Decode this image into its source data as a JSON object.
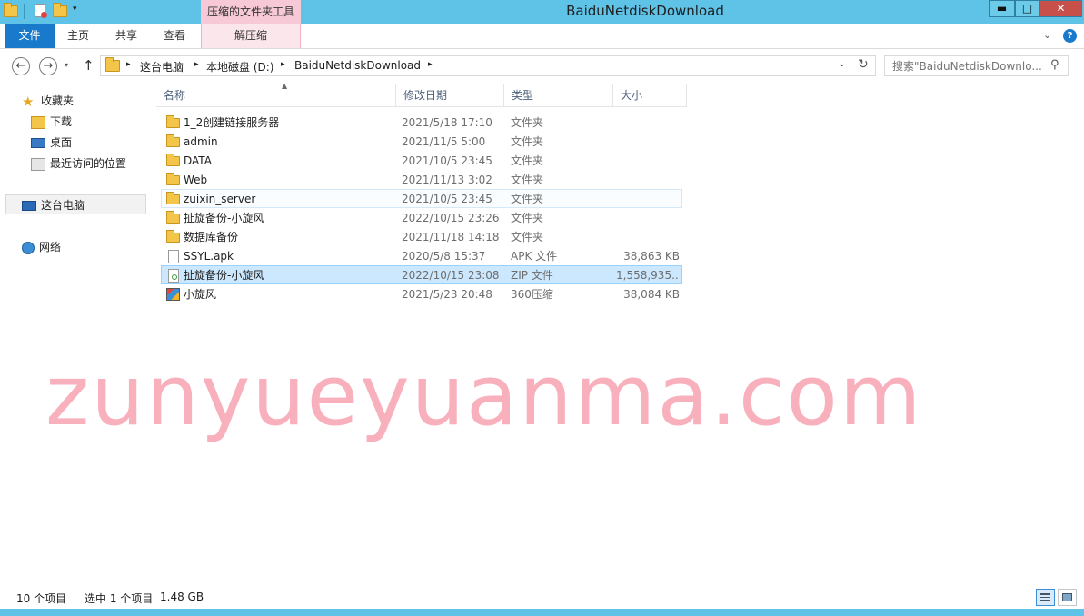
{
  "window": {
    "title": "BaiduNetdiskDownload"
  },
  "titlebar": {
    "context_tab_group": "压缩的文件夹工具",
    "minimize_symbol": "▬",
    "maximize_symbol": "□",
    "close_symbol": "✕",
    "qa_dropdown_symbol": "▾"
  },
  "ribbon": {
    "tabs": [
      {
        "label": "文件",
        "active": true
      },
      {
        "label": "主页"
      },
      {
        "label": "共享"
      },
      {
        "label": "查看"
      },
      {
        "label": "解压缩"
      }
    ],
    "collapse_symbol": "⌄",
    "help_symbol": "?"
  },
  "address": {
    "back_symbol": "←",
    "forward_symbol": "→",
    "recent_symbol": "▾",
    "up_symbol": "↑",
    "crumbs": [
      "这台电脑",
      "本地磁盘 (D:)",
      "BaiduNetdiskDownload"
    ],
    "crumb_separator": "▸",
    "dropdown_symbol": "⌄",
    "refresh_symbol": "↻"
  },
  "search": {
    "placeholder": "搜索\"BaiduNetdiskDownlo...",
    "icon_symbol": "⚲"
  },
  "navpane": {
    "favorites": "收藏夹",
    "downloads": "下载",
    "desktop": "桌面",
    "recent": "最近访问的位置",
    "this_pc": "这台电脑",
    "network": "网络",
    "star_symbol": "★"
  },
  "columns": {
    "name": "名称",
    "date": "修改日期",
    "type": "类型",
    "size": "大小",
    "sort_symbol": "▲"
  },
  "files": [
    {
      "name": "1_2创建链接服务器",
      "date": "2021/5/18 17:10",
      "type": "文件夹",
      "size": "",
      "icon": "folder-icon"
    },
    {
      "name": "admin",
      "date": "2021/11/5 5:00",
      "type": "文件夹",
      "size": "",
      "icon": "folder-icon"
    },
    {
      "name": "DATA",
      "date": "2021/10/5 23:45",
      "type": "文件夹",
      "size": "",
      "icon": "folder-icon"
    },
    {
      "name": "Web",
      "date": "2021/11/13 3:02",
      "type": "文件夹",
      "size": "",
      "icon": "folder-icon"
    },
    {
      "name": "zuixin_server",
      "date": "2021/10/5 23:45",
      "type": "文件夹",
      "size": "",
      "icon": "folder-icon"
    },
    {
      "name": "扯旋备份-小旋风",
      "date": "2022/10/15 23:26",
      "type": "文件夹",
      "size": "",
      "icon": "folder-icon"
    },
    {
      "name": "数据库备份",
      "date": "2021/11/18 14:18",
      "type": "文件夹",
      "size": "",
      "icon": "folder-icon"
    },
    {
      "name": "SSYL.apk",
      "date": "2020/5/8 15:37",
      "type": "APK 文件",
      "size": "38,863 KB",
      "icon": "file-icon"
    },
    {
      "name": "扯旋备份-小旋风",
      "date": "2022/10/15 23:08",
      "type": "ZIP 文件",
      "size": "1,558,935...",
      "icon": "zip-icon"
    },
    {
      "name": "小旋风",
      "date": "2021/5/23 20:48",
      "type": "360压缩",
      "size": "38,084 KB",
      "icon": "archive-icon"
    }
  ],
  "watermark": "zunyueyuanma.com",
  "status": {
    "item_count": "10 个项目",
    "selected": "选中 1 个项目",
    "selected_size": "1.48 GB"
  }
}
